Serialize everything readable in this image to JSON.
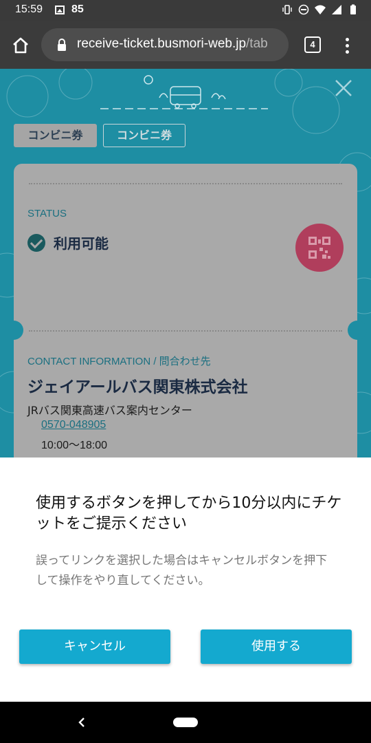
{
  "status_bar": {
    "time": "15:59",
    "notification_count": "85"
  },
  "browser": {
    "url_host": "receive-ticket.busmori-web.jp",
    "url_rest": "/tab",
    "tab_count": "4"
  },
  "page": {
    "tabs": [
      {
        "label": "コンビニ券"
      },
      {
        "label": "コンビニ券"
      }
    ],
    "status_label": "STATUS",
    "status_value": "利用可能",
    "contact_label": "CONTACT INFORMATION / 問合わせ先",
    "company": "ジェイアールバス関東株式会社",
    "center_name": "JRバス関東高速バス案内センター",
    "phone": "0570-048905",
    "hours": "10:00〜18:00"
  },
  "dialog": {
    "title": "使用するボタンを押してから10分以内にチケットをご提示ください",
    "body": "誤ってリンクを選択した場合はキャンセルボタンを押下して操作をやり直してください。",
    "cancel_label": "キャンセル",
    "use_label": "使用する"
  },
  "colors": {
    "accent": "#14a9cf",
    "page_bg": "#1e8ea3",
    "qr_button": "#b03e5c"
  }
}
